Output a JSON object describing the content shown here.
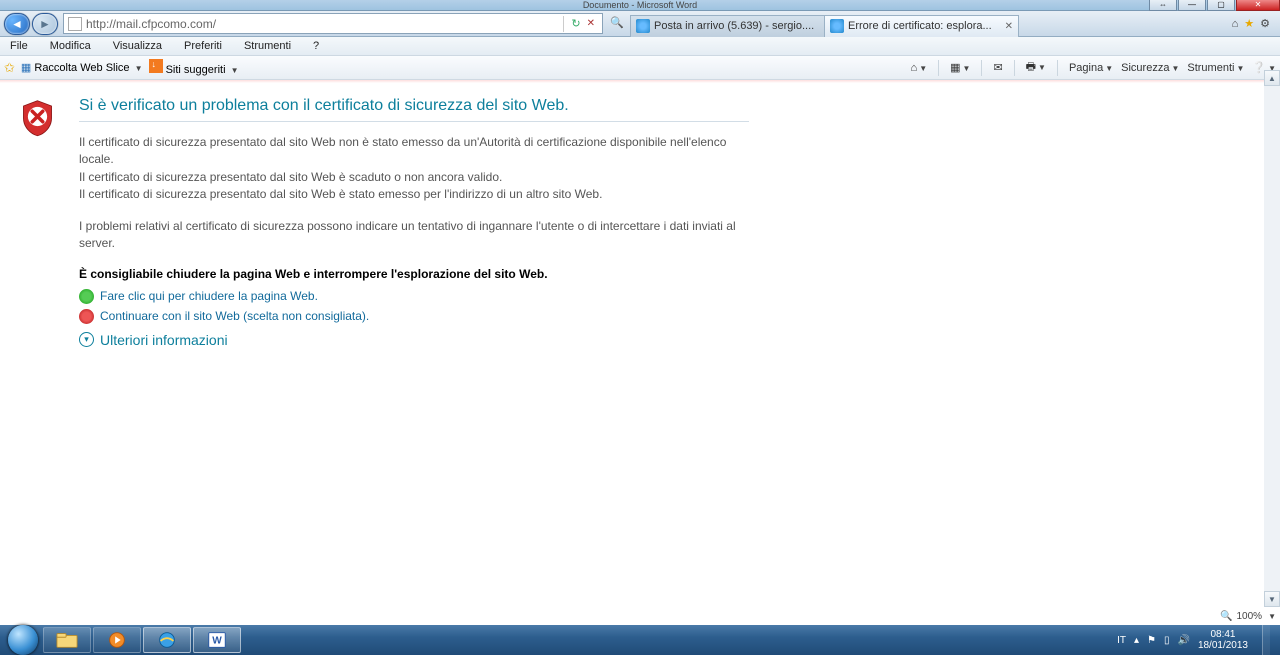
{
  "window": {
    "title_hint": "Documento  -  Microsoft Word"
  },
  "nav": {
    "url": "http://mail.cfpcomo.com/",
    "tabs": [
      {
        "label": "Posta in arrivo (5.639) - sergio...."
      },
      {
        "label": "Errore di certificato: esplora..."
      }
    ]
  },
  "menu": {
    "file": "File",
    "modifica": "Modifica",
    "visualizza": "Visualizza",
    "preferiti": "Preferiti",
    "strumenti": "Strumenti",
    "help": "?"
  },
  "favbar": {
    "webslice": "Raccolta Web Slice",
    "suggested": "Siti suggeriti",
    "cmd": {
      "pagina": "Pagina",
      "sicurezza": "Sicurezza",
      "strumenti": "Strumenti"
    }
  },
  "cert": {
    "heading": "Si è verificato un problema con il certificato di sicurezza del sito Web.",
    "p1a": "Il certificato di sicurezza presentato dal sito Web non è stato emesso da un'Autorità di certificazione disponibile nell'elenco locale.",
    "p1b": "Il certificato di sicurezza presentato dal sito Web è scaduto o non ancora valido.",
    "p1c": "Il certificato di sicurezza presentato dal sito Web è stato emesso per l'indirizzo di un altro sito Web.",
    "p2": "I problemi relativi al certificato di sicurezza possono indicare un tentativo di ingannare l'utente o di intercettare i dati inviati al server.",
    "recommend": "È consigliabile chiudere la pagina Web e interrompere l'esplorazione del sito Web.",
    "close_link": "Fare clic qui per chiudere la pagina Web.",
    "continue_link": "Continuare con il sito Web (scelta non consigliata).",
    "more": "Ulteriori informazioni"
  },
  "status": {
    "zoom": "100%"
  },
  "tray": {
    "lang": "IT",
    "time": "08:41",
    "date": "18/01/2013"
  }
}
